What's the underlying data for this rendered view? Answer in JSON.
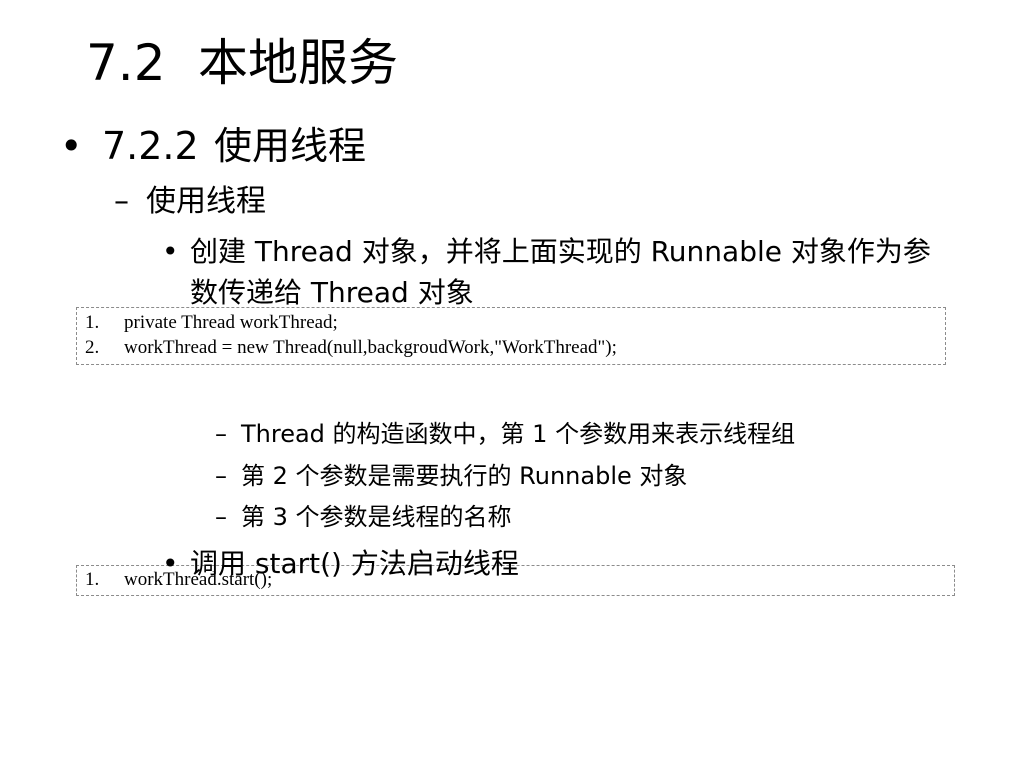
{
  "slide": {
    "title_number": "7.2",
    "title_text": "本地服务",
    "bullet1": {
      "number": "7.2.2",
      "text": "使用线程"
    },
    "sub1": "使用线程",
    "item1": "创建 Thread 对象，并将上面实现的 Runnable 对象作为参数传递给 Thread 对象",
    "code1": [
      {
        "num": "1.",
        "text": "private Thread workThread;"
      },
      {
        "num": "2.",
        "text": "workThread = new Thread(null,backgroudWork,\"WorkThread\");"
      }
    ],
    "notes": [
      "Thread 的构造函数中，第 1 个参数用来表示线程组",
      "第 2 个参数是需要执行的 Runnable 对象",
      "第 3 个参数是线程的名称"
    ],
    "item2": "调用 start() 方法启动线程",
    "code2": [
      {
        "num": "1.",
        "text": "workThread.start();"
      }
    ],
    "bullet_char": "•",
    "dash_char": "–"
  }
}
